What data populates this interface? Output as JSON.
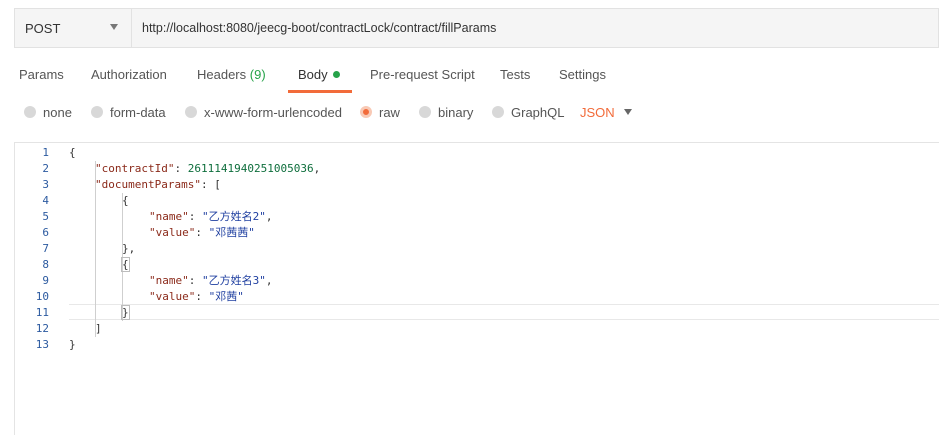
{
  "request": {
    "method": "POST",
    "url": "http://localhost:8080/jeecg-boot/contractLock/contract/fillParams"
  },
  "tabs": [
    {
      "label": "Params"
    },
    {
      "label": "Authorization"
    },
    {
      "label": "Headers",
      "count": "(9)"
    },
    {
      "label": "Body"
    },
    {
      "label": "Pre-request Script"
    },
    {
      "label": "Tests"
    },
    {
      "label": "Settings"
    }
  ],
  "body_types": [
    {
      "label": "none"
    },
    {
      "label": "form-data"
    },
    {
      "label": "x-www-form-urlencoded"
    },
    {
      "label": "raw",
      "selected": true
    },
    {
      "label": "binary"
    },
    {
      "label": "GraphQL"
    }
  ],
  "format": "JSON",
  "colors": {
    "accent": "#f26b3a",
    "success": "#26a34a"
  },
  "editor": {
    "line_numbers": [
      "1",
      "2",
      "3",
      "4",
      "5",
      "6",
      "7",
      "8",
      "9",
      "10",
      "11",
      "12",
      "13"
    ],
    "tokens": {
      "open_brace": "{",
      "close_brace": "}",
      "close_brace_comma": "},",
      "open_bracket_key": "\"documentParams\"",
      "contract_key": "\"contractId\"",
      "contract_value": "2611141940251005036",
      "name_key": "\"name\"",
      "value_key": "\"value\"",
      "name1": "\"乙方姓名2\"",
      "value1": "\"邓茜茜\"",
      "name2": "\"乙方姓名3\"",
      "value2": "\"邓茜\"",
      "colon": ": ",
      "comma": ",",
      "open_bracket": "[",
      "close_bracket": "]"
    }
  }
}
